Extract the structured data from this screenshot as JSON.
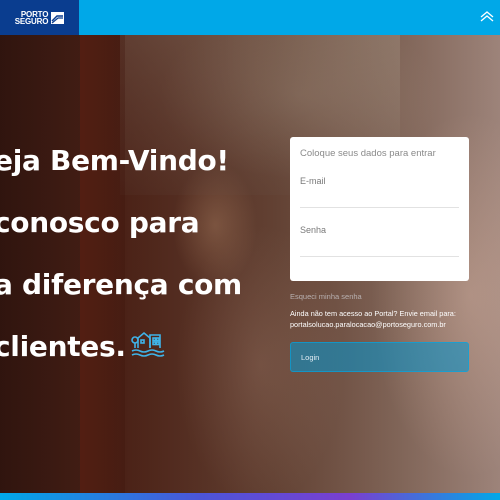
{
  "colors": {
    "topbar": "#00a8e8",
    "logo_bg": "#0a3d8f",
    "button_bg": "#0096d2",
    "card_bg": "#ffffff"
  },
  "header": {
    "logo_line1": "PORTO",
    "logo_line2": "SEGURO",
    "right_icon": "home-icon"
  },
  "hero": {
    "lines": [
      "eja Bem-Vindo!",
      "conosco para",
      "a diferença com",
      "clientes."
    ],
    "icon": "house-icon"
  },
  "login": {
    "title": "Coloque seus dados para entrar",
    "email_label": "E-mail",
    "password_label": "Senha",
    "forgot_link": "Esqueci minha senha",
    "no_access_text": "Ainda não tem acesso ao Portal? Envie email para:",
    "contact_email": "portalsolucao.paralocacao@portoseguro.com.br",
    "login_button": "Login"
  }
}
